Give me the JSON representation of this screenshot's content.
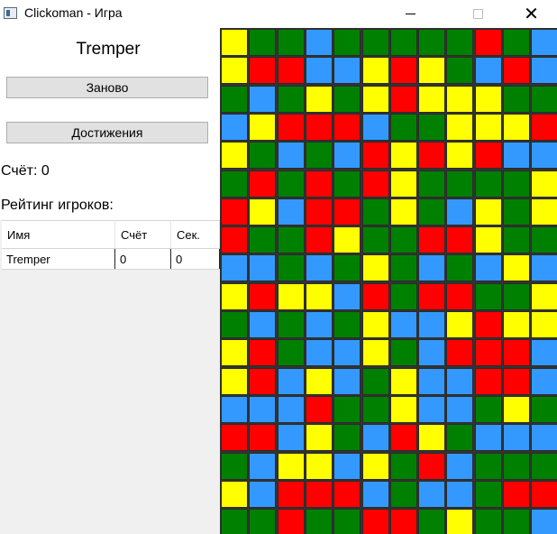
{
  "window": {
    "title": "Clickoman - Игра"
  },
  "left_panel": {
    "player_name": "Tremper",
    "restart_label": "Заново",
    "achievements_label": "Достижения",
    "score_text": "Счёт: 0",
    "rating_title": "Рейтинг игроков:"
  },
  "table": {
    "headers": {
      "name": "Имя",
      "score": "Счёт",
      "seconds": "Сек."
    },
    "rows": [
      {
        "name": "Tremper",
        "score": "0",
        "seconds": "0"
      }
    ]
  },
  "colors": {
    "Y": "#ffff00",
    "G": "#008000",
    "B": "#3399ff",
    "R": "#ff0000"
  },
  "grid": [
    "YGGBGGGGGRGB",
    "YRRBBYRYGBRB",
    "GBGYGYRYYYGG",
    "BYRRRBGGYYYR",
    "YGBGBRYRYRBB",
    "GRGRGRYGGGGY",
    "RYBRRGYGBYGY",
    "RGGRYGGRRYGG",
    "BBGBGYGBGBYB",
    "YRYYBRGRRGGY",
    "GBGBGYBBYRYY",
    "YRGBBYGBRRRB",
    "YRBYBGYBBRRB",
    "BBBRGGYBBGYG",
    "RRBYGBRYGBBB",
    "GBYYBYGRBGGG",
    "YBRRRBGBBGRR",
    "GGRGGRRGYGGB"
  ]
}
